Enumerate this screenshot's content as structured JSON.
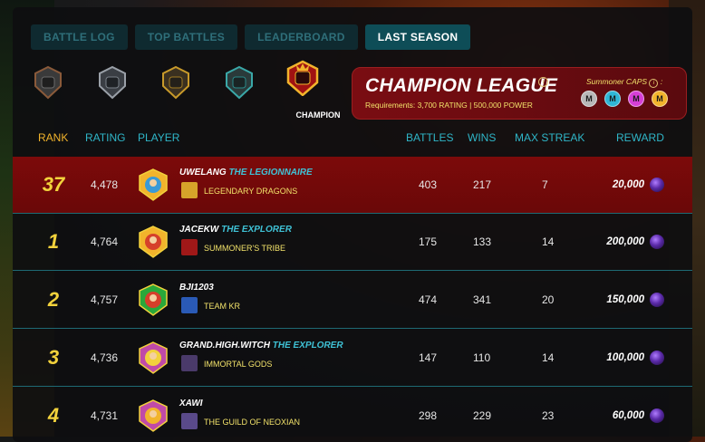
{
  "tabs": [
    {
      "label": "BATTLE LOG",
      "active": false
    },
    {
      "label": "TOP BATTLES",
      "active": false
    },
    {
      "label": "LEADERBOARD",
      "active": false
    },
    {
      "label": "LAST SEASON",
      "active": true
    }
  ],
  "league_selector": {
    "leagues": [
      "novice-badge",
      "bronze-badge",
      "gold-badge",
      "diamond-badge",
      "champion-badge"
    ],
    "selected_label": "CHAMPION"
  },
  "league_card": {
    "title": "CHAMPION LEAGUE",
    "requirements": "Requirements: 3,700 RATING | 500,000 POWER",
    "caps_label": "Summoner CAPS",
    "caps": [
      {
        "letter": "M",
        "color": "#b8b8b8"
      },
      {
        "letter": "M",
        "color": "#2fb6d6"
      },
      {
        "letter": "M",
        "color": "#d63fd6"
      },
      {
        "letter": "M",
        "color": "#f2b42c"
      }
    ]
  },
  "columns": {
    "rank": "RANK",
    "rating": "RATING",
    "player": "PLAYER",
    "battles": "BATTLES",
    "wins": "WINS",
    "max_streak": "MAX STREAK",
    "reward": "REWARD"
  },
  "rows": [
    {
      "rank": "37",
      "rating": "4,478",
      "name": "UWELANG",
      "title": "THE LEGIONNAIRE",
      "guild": "LEGENDARY DRAGONS",
      "battles": "403",
      "wins": "217",
      "streak": "7",
      "reward": "20,000",
      "highlight": true
    },
    {
      "rank": "1",
      "rating": "4,764",
      "name": "JACEKW",
      "title": "THE EXPLORER",
      "guild": "SUMMONER'S TRIBE",
      "battles": "175",
      "wins": "133",
      "streak": "14",
      "reward": "200,000",
      "highlight": false
    },
    {
      "rank": "2",
      "rating": "4,757",
      "name": "BJI1203",
      "title": "",
      "guild": "TEAM KR",
      "battles": "474",
      "wins": "341",
      "streak": "20",
      "reward": "150,000",
      "highlight": false
    },
    {
      "rank": "3",
      "rating": "4,736",
      "name": "GRAND.HIGH.WITCH",
      "title": "THE EXPLORER",
      "guild": "IMMORTAL GODS",
      "battles": "147",
      "wins": "110",
      "streak": "14",
      "reward": "100,000",
      "highlight": false
    },
    {
      "rank": "4",
      "rating": "4,731",
      "name": "XAWI",
      "title": "",
      "guild": "THE GUILD OF NEOXIAN",
      "battles": "298",
      "wins": "229",
      "streak": "23",
      "reward": "60,000",
      "highlight": false
    }
  ],
  "colors": {
    "accent": "#2fb6c8",
    "rank_header": "#f2b42c",
    "highlight_row": "#7c0a0a",
    "guild_text": "#f2e26a"
  }
}
